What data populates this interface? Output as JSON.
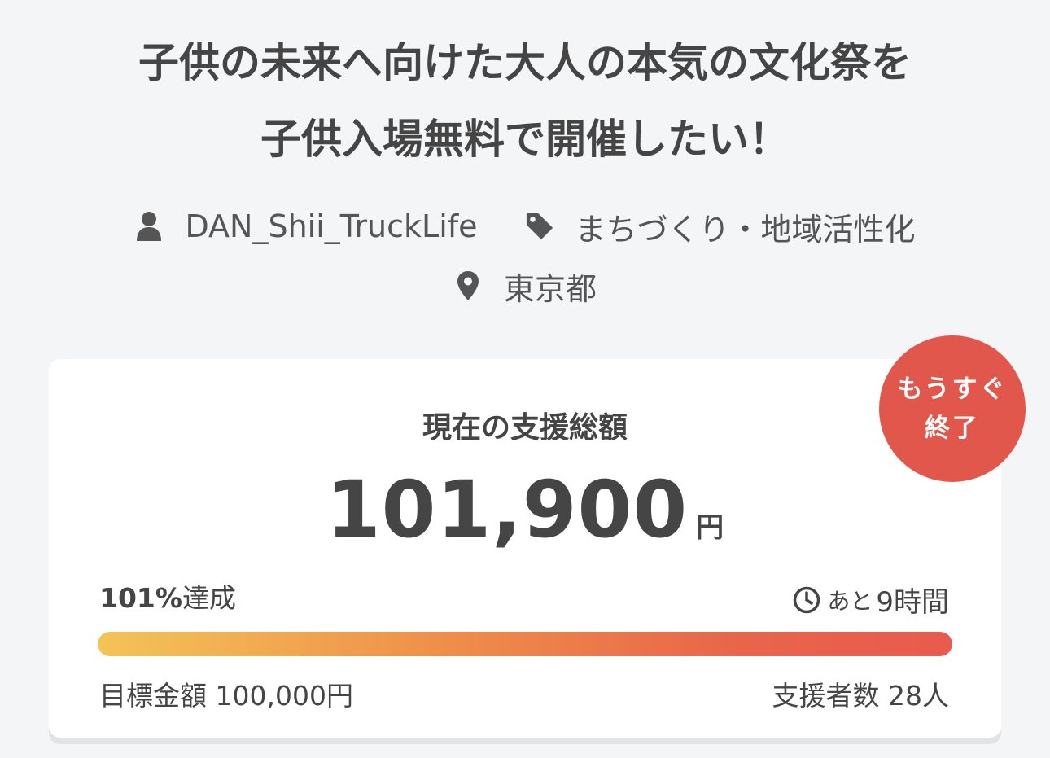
{
  "project": {
    "title_line1": "子供の未来へ向けた大人の本気の文化祭を",
    "title_line2": "子供入場無料で開催したい！",
    "owner": "DAN_Shii_TruckLife",
    "category": "まちづくり・地域活性化",
    "location": "東京都",
    "icons": {
      "owner": "user-icon",
      "category": "tag-icon",
      "location": "map-pin-icon",
      "time": "clock-icon"
    }
  },
  "funding": {
    "badge_line1": "もうすぐ",
    "badge_line2": "終了",
    "label": "現在の支援総額",
    "amount": "101,900",
    "amount_unit": "円",
    "achieved_percent": "101%",
    "achieved_suffix": "達成",
    "remaining_prefix": "あと",
    "remaining_value": "9時間",
    "progress_fraction": 1.0,
    "goal_label": "目標金額 100,000円",
    "supporters_label": "支援者数 28人",
    "colors": {
      "badge": "#e1574c",
      "bar_start": "#f3c456",
      "bar_end": "#e85b4f"
    }
  }
}
